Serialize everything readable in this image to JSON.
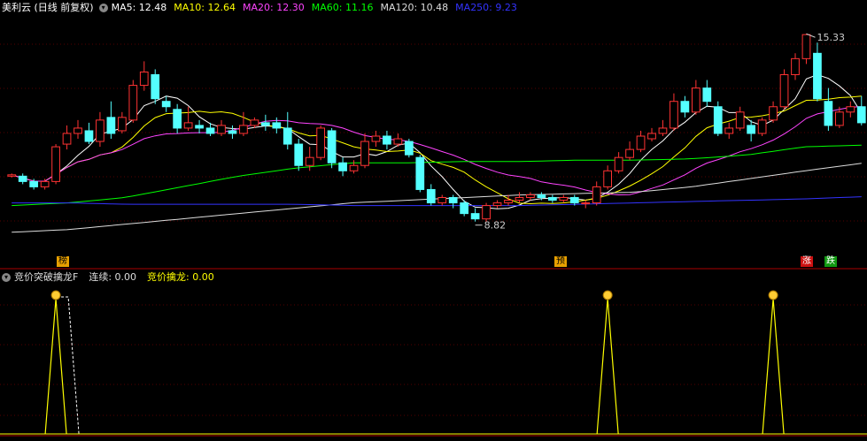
{
  "main_header": {
    "title": "美利云 (日线 前复权)",
    "indicators": [
      {
        "label": "MA5: 12.48",
        "color": "#ffffff"
      },
      {
        "label": "MA10: 12.64",
        "color": "#ffff00"
      },
      {
        "label": "MA20: 12.30",
        "color": "#ff44ff"
      },
      {
        "label": "MA60: 11.16",
        "color": "#00ff00"
      },
      {
        "label": "MA120: 10.48",
        "color": "#dddddd"
      },
      {
        "label": "MA250: 9.23",
        "color": "#3333ff"
      }
    ]
  },
  "sub_header": {
    "title": "竞价突破擒龙F",
    "items": [
      {
        "label": "连续: 0.00",
        "color": "#dddddd"
      },
      {
        "label": "竞价擒龙: 0.00",
        "color": "#ffff00"
      }
    ]
  },
  "markers": {
    "left": "榜",
    "mid": "预",
    "right1": "涨",
    "right2": "跌"
  },
  "annotations": {
    "high": "15.33",
    "low": "8.82"
  },
  "colors": {
    "up": "#ff3333",
    "down": "#54ffff",
    "separator": "#aa0000",
    "grid": "#550000"
  },
  "chart_data": {
    "type": "candlestick",
    "title": "美利云 (日线 前复权)",
    "ylim": [
      7.0,
      16.0
    ],
    "candles": [
      [
        10.0,
        10.05,
        9.95,
        10.1
      ],
      [
        10.0,
        9.8,
        9.7,
        10.1
      ],
      [
        9.8,
        9.6,
        9.5,
        9.9
      ],
      [
        9.6,
        9.8,
        9.5,
        9.9
      ],
      [
        9.8,
        11.1,
        9.7,
        11.2
      ],
      [
        11.2,
        11.6,
        11.0,
        11.9
      ],
      [
        11.6,
        11.8,
        11.4,
        12.1
      ],
      [
        11.7,
        11.3,
        11.2,
        12.0
      ],
      [
        11.3,
        12.1,
        11.1,
        12.4
      ],
      [
        12.2,
        11.6,
        11.4,
        12.8
      ],
      [
        11.7,
        12.2,
        11.6,
        12.4
      ],
      [
        12.1,
        13.4,
        12.0,
        13.6
      ],
      [
        13.4,
        13.9,
        13.2,
        14.3
      ],
      [
        13.8,
        12.9,
        12.7,
        14.0
      ],
      [
        12.8,
        12.6,
        12.4,
        13.0
      ],
      [
        12.5,
        11.8,
        11.6,
        12.7
      ],
      [
        11.8,
        12.0,
        11.7,
        12.6
      ],
      [
        11.9,
        11.8,
        11.6,
        12.1
      ],
      [
        11.8,
        11.6,
        11.5,
        12.0
      ],
      [
        11.6,
        11.9,
        11.5,
        12.1
      ],
      [
        11.7,
        11.6,
        11.4,
        11.9
      ],
      [
        11.6,
        11.9,
        11.5,
        12.4
      ],
      [
        11.9,
        12.1,
        11.8,
        12.2
      ],
      [
        12.0,
        11.9,
        11.7,
        12.3
      ],
      [
        12.0,
        11.8,
        11.6,
        12.2
      ],
      [
        11.8,
        11.2,
        11.0,
        12.4
      ],
      [
        11.2,
        10.4,
        10.2,
        11.4
      ],
      [
        10.4,
        10.7,
        10.2,
        11.1
      ],
      [
        10.7,
        11.8,
        10.6,
        11.9
      ],
      [
        11.7,
        10.5,
        10.3,
        11.8
      ],
      [
        10.5,
        10.2,
        10.0,
        10.7
      ],
      [
        10.2,
        10.4,
        10.1,
        10.6
      ],
      [
        10.4,
        11.3,
        10.3,
        11.6
      ],
      [
        11.3,
        11.5,
        11.1,
        11.7
      ],
      [
        11.5,
        11.2,
        11.0,
        11.7
      ],
      [
        11.2,
        11.4,
        11.1,
        11.6
      ],
      [
        11.3,
        10.8,
        10.7,
        11.4
      ],
      [
        10.7,
        9.5,
        9.4,
        10.8
      ],
      [
        9.5,
        9.0,
        8.9,
        9.7
      ],
      [
        9.0,
        9.2,
        8.9,
        9.3
      ],
      [
        9.2,
        9.0,
        8.8,
        9.3
      ],
      [
        9.0,
        8.6,
        8.5,
        9.1
      ],
      [
        8.6,
        8.4,
        8.3,
        8.8
      ],
      [
        8.4,
        8.9,
        8.3,
        9.0
      ],
      [
        8.9,
        9.0,
        8.8,
        9.1
      ],
      [
        9.0,
        9.1,
        8.9,
        9.3
      ],
      [
        9.1,
        9.2,
        9.0,
        9.4
      ],
      [
        9.2,
        9.3,
        9.1,
        9.4
      ],
      [
        9.3,
        9.2,
        9.1,
        9.4
      ],
      [
        9.2,
        9.1,
        9.0,
        9.3
      ],
      [
        9.1,
        9.2,
        9.0,
        9.3
      ],
      [
        9.2,
        9.0,
        8.9,
        9.3
      ],
      [
        9.0,
        9.0,
        8.8,
        9.1
      ],
      [
        9.0,
        9.6,
        8.9,
        9.8
      ],
      [
        9.6,
        10.2,
        9.5,
        10.4
      ],
      [
        10.2,
        10.7,
        10.1,
        10.9
      ],
      [
        10.7,
        11.0,
        10.6,
        11.3
      ],
      [
        11.0,
        11.5,
        10.9,
        11.7
      ],
      [
        11.4,
        11.6,
        11.3,
        11.8
      ],
      [
        11.6,
        11.8,
        11.5,
        12.1
      ],
      [
        11.8,
        12.8,
        11.7,
        13.1
      ],
      [
        12.8,
        12.4,
        12.2,
        13.0
      ],
      [
        12.4,
        13.3,
        12.3,
        13.6
      ],
      [
        13.3,
        12.8,
        12.6,
        13.6
      ],
      [
        12.6,
        11.6,
        11.5,
        12.8
      ],
      [
        11.6,
        11.8,
        11.4,
        12.0
      ],
      [
        11.8,
        12.4,
        11.7,
        12.6
      ],
      [
        11.9,
        11.6,
        11.3,
        12.1
      ],
      [
        11.6,
        12.1,
        11.5,
        12.2
      ],
      [
        12.1,
        12.6,
        12.0,
        12.8
      ],
      [
        12.6,
        13.8,
        12.5,
        14.0
      ],
      [
        13.8,
        14.4,
        13.6,
        14.6
      ],
      [
        14.4,
        15.3,
        14.2,
        15.33
      ],
      [
        14.6,
        12.9,
        12.8,
        15.0
      ],
      [
        12.8,
        11.9,
        11.7,
        13.3
      ],
      [
        11.9,
        12.4,
        11.8,
        12.6
      ],
      [
        12.4,
        12.6,
        12.2,
        12.8
      ],
      [
        12.6,
        12.0,
        11.9,
        13.0
      ]
    ],
    "ma": [
      {
        "name": "MA5",
        "color": "#ffffff"
      },
      {
        "name": "MA10",
        "color": "#ffff00"
      },
      {
        "name": "MA20",
        "color": "#ff44ff"
      },
      {
        "name": "MA60",
        "color": "#00ff00"
      },
      {
        "name": "MA120",
        "color": "#dddddd"
      },
      {
        "name": "MA250",
        "color": "#3333ff"
      }
    ],
    "ma_anchor_values": {
      "MA60": [
        8.9,
        9.0,
        9.2,
        9.6,
        10.0,
        10.3,
        10.5,
        10.5,
        10.55,
        10.55,
        10.6,
        10.6,
        10.65,
        10.8,
        11.1,
        11.16
      ],
      "MA120": [
        7.9,
        8.0,
        8.2,
        8.4,
        8.6,
        8.8,
        9.0,
        9.1,
        9.2,
        9.3,
        9.35,
        9.4,
        9.6,
        9.9,
        10.2,
        10.48
      ],
      "MA250": [
        9.0,
        9.0,
        8.95,
        8.95,
        8.95,
        8.95,
        8.9,
        8.9,
        8.9,
        8.9,
        8.95,
        9.0,
        9.05,
        9.1,
        9.15,
        9.23
      ]
    },
    "subchart": {
      "name": "竞价擒龙",
      "signal_indices": [
        4,
        54,
        69
      ],
      "values": "0/1 pulses at signal indices"
    }
  }
}
